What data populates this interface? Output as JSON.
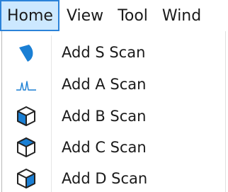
{
  "menubar": {
    "items": [
      {
        "label": "Home"
      },
      {
        "label": "View"
      },
      {
        "label": "Tool"
      },
      {
        "label": "Wind"
      }
    ]
  },
  "dropdown": {
    "items": [
      {
        "label": "Add S Scan",
        "icon": "s-scan-icon"
      },
      {
        "label": "Add A Scan",
        "icon": "a-scan-icon"
      },
      {
        "label": "Add B Scan",
        "icon": "b-scan-icon"
      },
      {
        "label": "Add C Scan",
        "icon": "c-scan-icon"
      },
      {
        "label": "Add D Scan",
        "icon": "d-scan-icon"
      }
    ]
  },
  "colors": {
    "active_menu_bg": "#cce8ff",
    "active_menu_border": "#2b82d9",
    "icon_blue": "#1a7fd4"
  }
}
